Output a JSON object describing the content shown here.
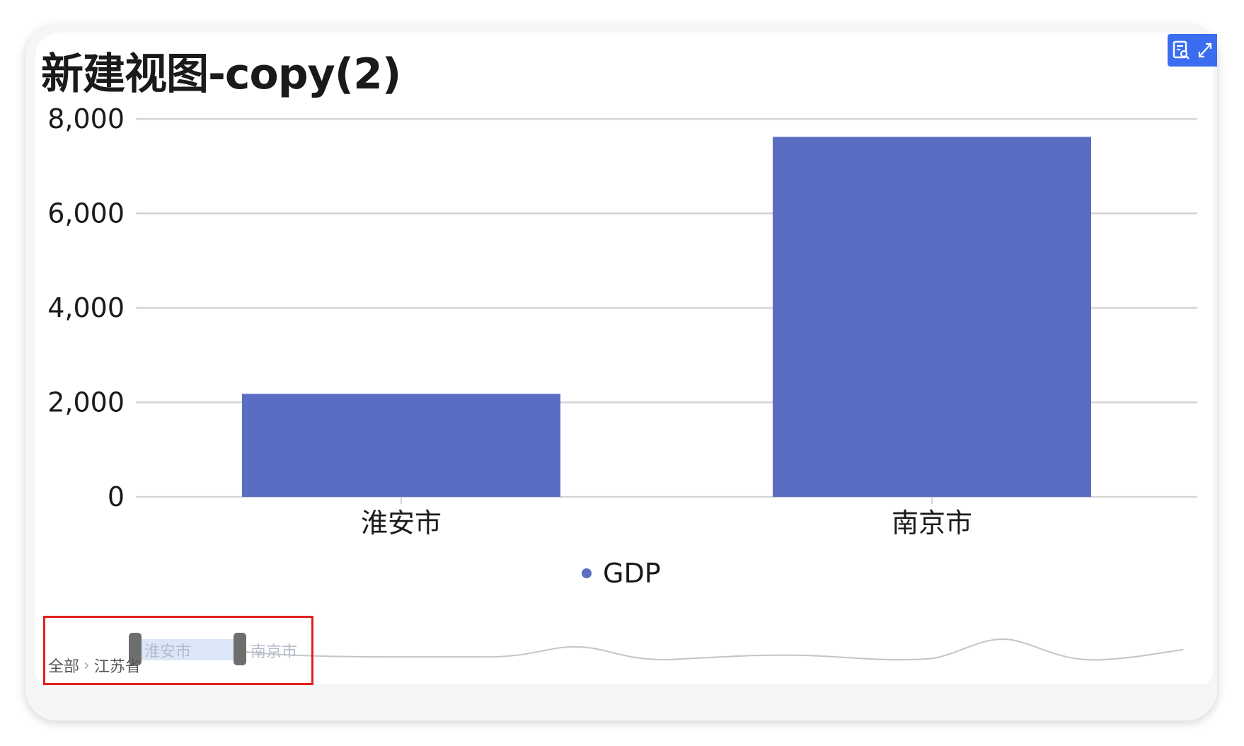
{
  "title": "新建视图-copy(2)",
  "toolbar": {
    "icons": [
      "view-data-icon",
      "expand-icon"
    ]
  },
  "colors": {
    "bar": "#5a6dc2",
    "grid": "#d4d4d4",
    "toolbar_bg": "#3a6df0",
    "highlight": "#e02020",
    "slider_fill": "#dbe6f6"
  },
  "chart_data": {
    "type": "bar",
    "categories": [
      "淮安市",
      "南京市"
    ],
    "series": [
      {
        "name": "GDP",
        "values": [
          2180,
          7620
        ]
      }
    ],
    "ylim": [
      0,
      8000
    ],
    "yticks": [
      0,
      2000,
      4000,
      6000,
      8000
    ],
    "ytick_labels": [
      "0",
      "2,000",
      "4,000",
      "6,000",
      "8,000"
    ],
    "grid": true,
    "legend_position": "bottom-center"
  },
  "data_zoom": {
    "start_label": "淮安市",
    "end_label": "南京市"
  },
  "breadcrumb": [
    "全部",
    "江苏省"
  ],
  "breadcrumb_separator": "›"
}
